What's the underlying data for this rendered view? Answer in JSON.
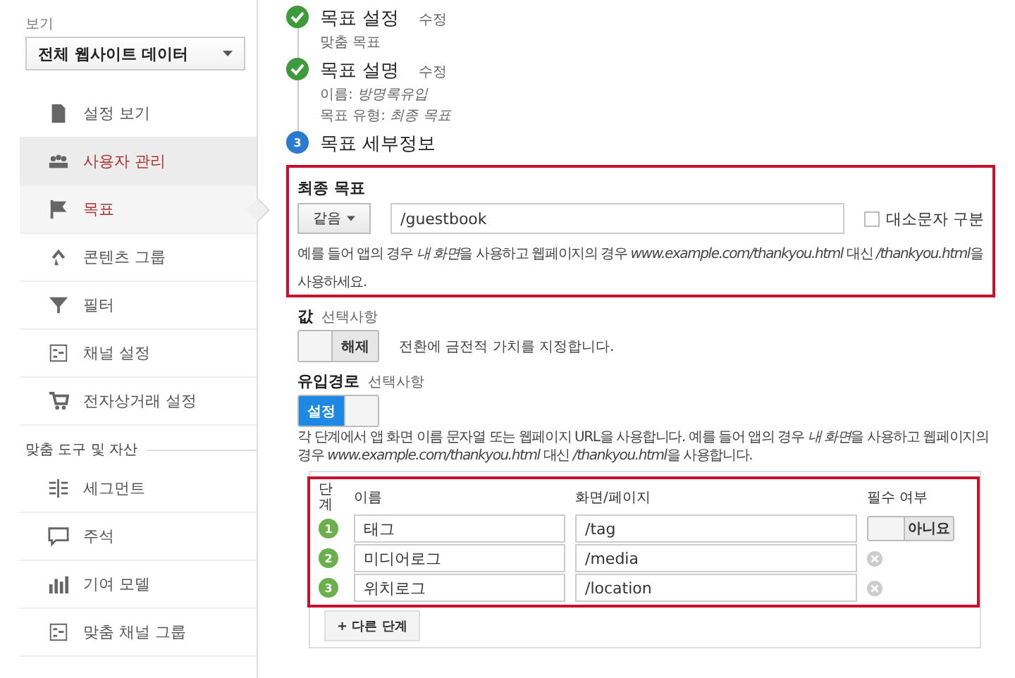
{
  "sidebar": {
    "view_label": "보기",
    "view_select": "전체 웹사이트 데이터",
    "items": [
      {
        "label": "설정 보기",
        "selected": false,
        "hovered": false
      },
      {
        "label": "사용자 관리",
        "selected": false,
        "hovered": true
      },
      {
        "label": "목표",
        "selected": true,
        "hovered": false
      },
      {
        "label": "콘텐츠 그룹",
        "selected": false,
        "hovered": false
      },
      {
        "label": "필터",
        "selected": false,
        "hovered": false
      },
      {
        "label": "채널 설정",
        "selected": false,
        "hovered": false
      },
      {
        "label": "전자상거래 설정",
        "selected": false,
        "hovered": false
      }
    ],
    "section_heading": "맞춤 도구 및 자산",
    "section_items": [
      {
        "label": "세그먼트",
        "selected": false,
        "hovered": false
      },
      {
        "label": "주석",
        "selected": false,
        "hovered": false
      },
      {
        "label": "기여 모델",
        "selected": false,
        "hovered": false
      },
      {
        "label": "맞춤 채널 그룹",
        "selected": false,
        "hovered": false
      }
    ]
  },
  "steps": [
    {
      "done": true,
      "title": "목표 설정",
      "edit_link": "수정",
      "details": [
        [
          {
            "text": "맞춤 목표",
            "italic": false
          }
        ]
      ]
    },
    {
      "done": true,
      "title": "목표 설명",
      "edit_link": "수정",
      "details": [
        [
          {
            "text": "이름: ",
            "italic": false
          },
          {
            "text": "방명록유입",
            "italic": true
          }
        ],
        [
          {
            "text": "목표 유형: ",
            "italic": false
          },
          {
            "text": "최종 목표",
            "italic": true
          }
        ]
      ]
    },
    {
      "done": false,
      "number": "3",
      "title": "목표 세부정보"
    }
  ],
  "destination": {
    "heading": "최종 목표",
    "match_type": "같음",
    "value": "/guestbook",
    "case_sensitive": {
      "label": "대소문자 구분",
      "checked": false
    },
    "hint": [
      {
        "text": "예를 들어 앱의 경우 ",
        "italic": false
      },
      {
        "text": "내 화면",
        "italic": true
      },
      {
        "text": "을 사용하고 웹페이지의 경우 ",
        "italic": false
      },
      {
        "text": "www.example.com/thankyou.html",
        "italic": true
      },
      {
        "text": " 대신 ",
        "italic": false
      },
      {
        "text": "/thankyou.html",
        "italic": true
      },
      {
        "text": "을 사용하세요.",
        "italic": false
      }
    ]
  },
  "value": {
    "label": "값",
    "optional": "선택사항",
    "toggle": {
      "on": false,
      "label": "해제"
    },
    "description": "전환에 금전적 가치를 지정합니다."
  },
  "funnel": {
    "label": "유입경로",
    "optional": "선택사항",
    "toggle": {
      "on": true,
      "label": "설정"
    },
    "hint": [
      {
        "text": "각 단계에서 앱 화면 이름 문자열 또는 웹페이지 URL을 사용합니다. 예를 들어 앱의 경우 ",
        "italic": false
      },
      {
        "text": "내 화면",
        "italic": true
      },
      {
        "text": "을 사용하고 웹페이지의 경우 ",
        "italic": false
      },
      {
        "text": "www.example.com/thankyou.html",
        "italic": true
      },
      {
        "text": " 대신 ",
        "italic": false
      },
      {
        "text": "/thankyou.html",
        "italic": true
      },
      {
        "text": "을 사용합니다.",
        "italic": false
      }
    ],
    "columns": [
      "단계",
      "이름",
      "화면/페이지",
      "필수 여부"
    ],
    "rows": [
      {
        "number": "1",
        "name": "태그",
        "page": "/tag",
        "kind": "toggle",
        "required": {
          "on": false,
          "label": "아니요"
        }
      },
      {
        "number": "2",
        "name": "미디어로그",
        "page": "/media",
        "kind": "remove"
      },
      {
        "number": "3",
        "name": "위치로그",
        "page": "/location",
        "kind": "remove"
      }
    ],
    "add_step": "+ 다른 단계"
  }
}
